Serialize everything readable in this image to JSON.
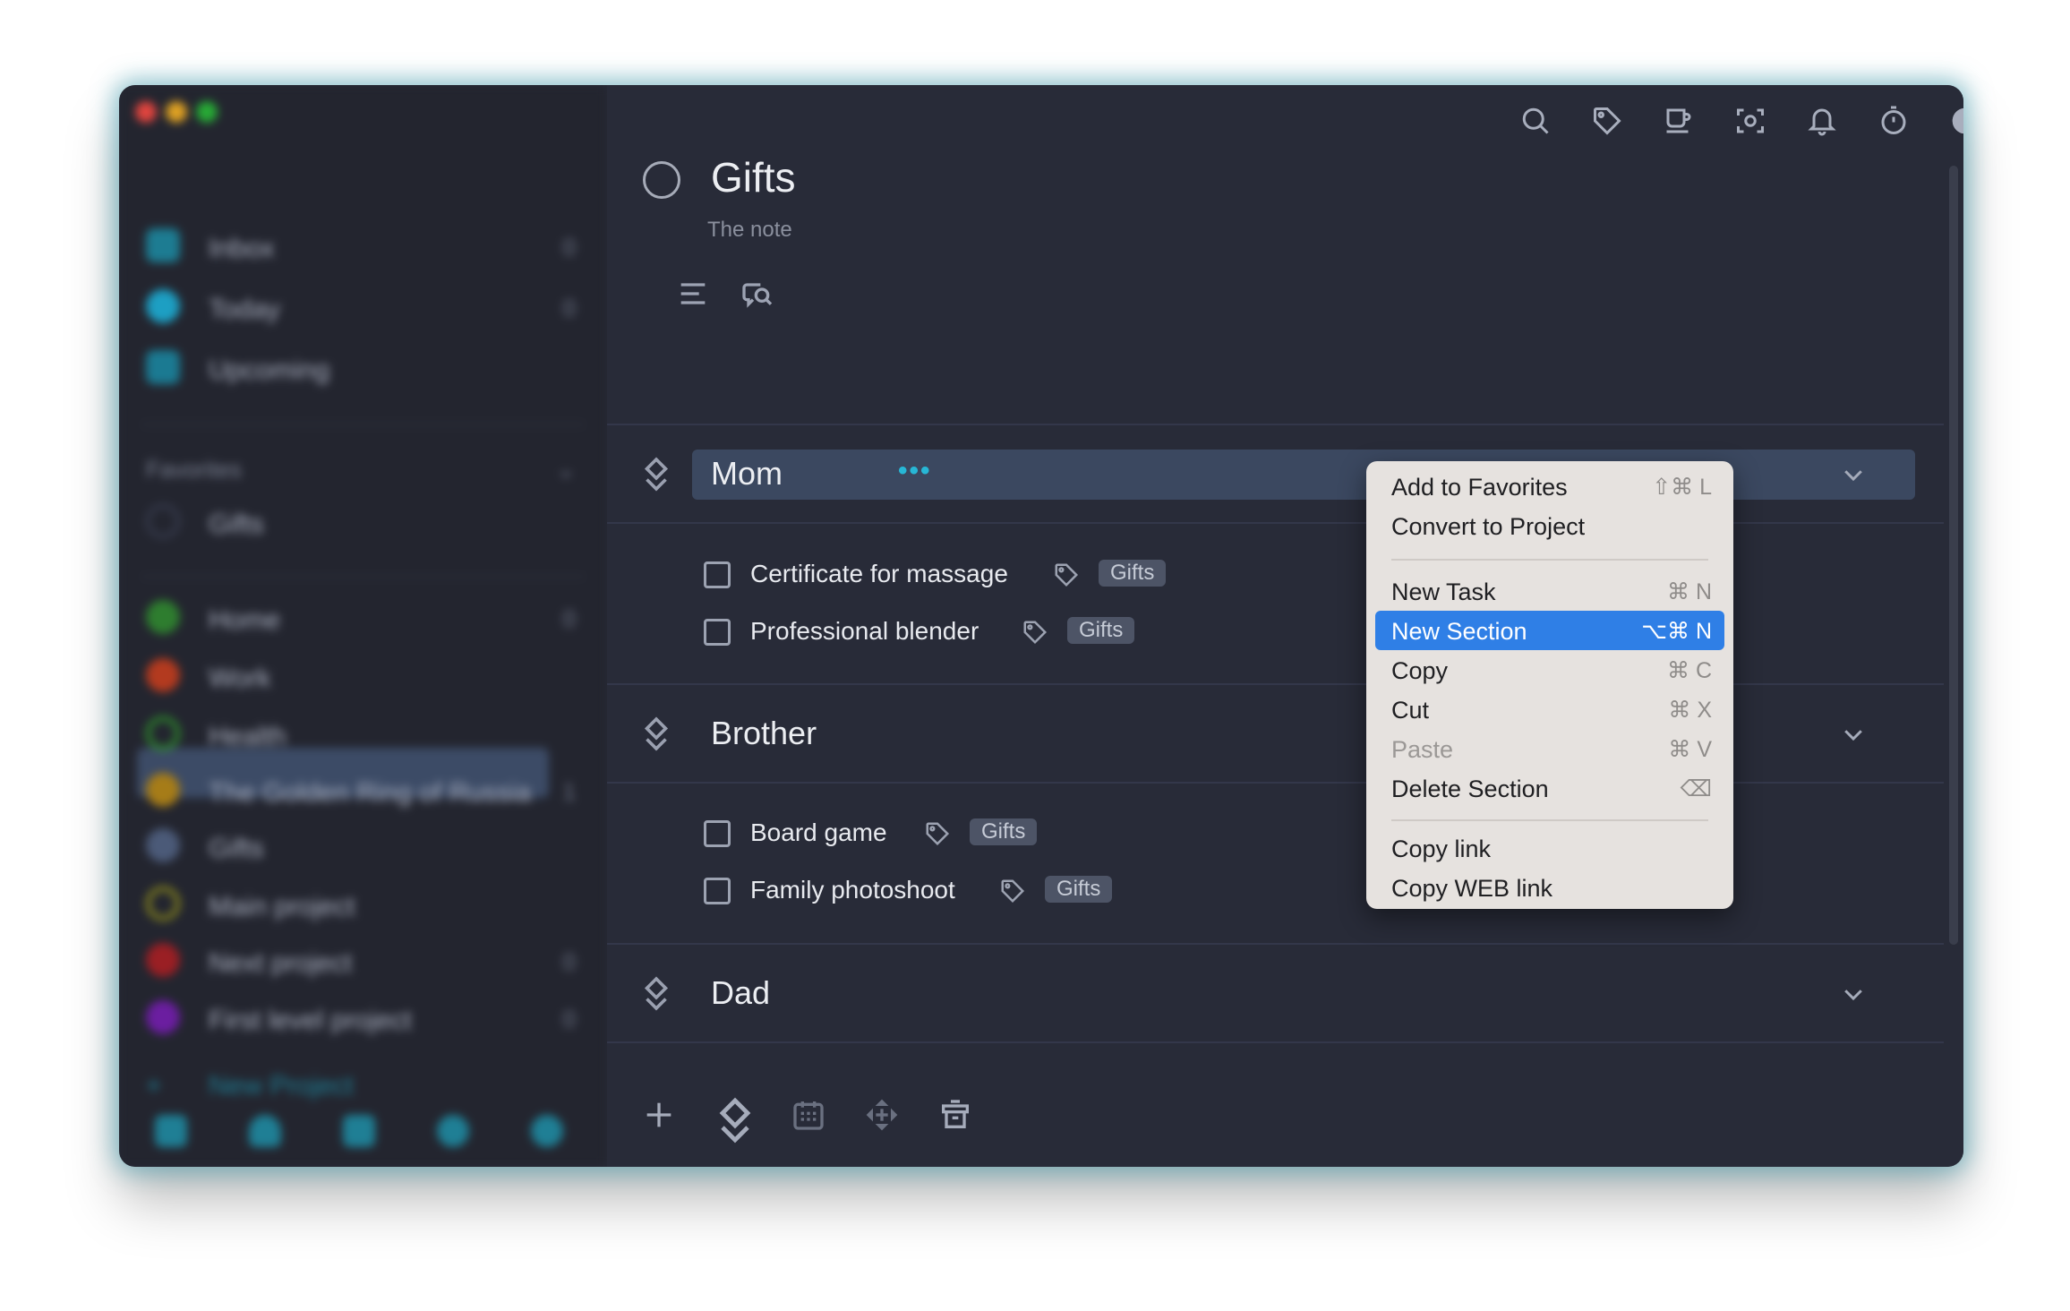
{
  "sidebar": {
    "items": [
      {
        "label": "Inbox",
        "count": "0",
        "color": "#1d7c92"
      },
      {
        "label": "Today",
        "count": "0",
        "color": "#1d9fc3"
      },
      {
        "label": "Upcoming",
        "count": "",
        "color": "#1b7a92"
      }
    ],
    "favorites_heading": "Favorites",
    "favorites": [
      {
        "label": "Gifts",
        "color": "#3a3f52"
      }
    ],
    "projects": [
      {
        "label": "Home",
        "count": "0",
        "color": "#2e7d2f"
      },
      {
        "label": "Work",
        "count": "",
        "color": "#b33a1f"
      },
      {
        "label": "Health",
        "count": "",
        "color": "#2d8f2b"
      },
      {
        "label": "The Golden Ring of Russia",
        "count": "1",
        "color": "#a67c18"
      },
      {
        "label": "Gifts",
        "count": "",
        "color": "#3c4b66"
      },
      {
        "label": "Main project",
        "count": "",
        "color": "#8c8a1c"
      },
      {
        "label": "Next project",
        "count": "0",
        "color": "#9a1f24"
      },
      {
        "label": "First level project",
        "count": "0",
        "color": "#6b1ea0"
      }
    ],
    "new_project": "New Project",
    "accent_color": "#1f7f95"
  },
  "toolbar": {
    "icons": [
      "search-icon",
      "tag-icon",
      "coffee-icon",
      "focus-icon",
      "bell-icon",
      "timer-icon",
      "contrast-icon",
      "duplicate-icon"
    ]
  },
  "project": {
    "title": "Gifts",
    "note": "The note",
    "note_icons": [
      "list-icon",
      "search-comment-icon"
    ]
  },
  "sections": [
    {
      "title": "Mom",
      "more": "•••",
      "tasks": [
        {
          "label": "Certificate for massage",
          "tag": "Gifts"
        },
        {
          "label": "Professional blender",
          "tag": "Gifts"
        }
      ]
    },
    {
      "title": "Brother",
      "tasks": [
        {
          "label": "Board game",
          "tag": "Gifts"
        },
        {
          "label": "Family photoshoot",
          "tag": "Gifts"
        }
      ]
    },
    {
      "title": "Dad",
      "tasks": []
    }
  ],
  "context_menu": {
    "items": [
      {
        "label": "Add to Favorites",
        "shortcut": "⇧⌘ L"
      },
      {
        "label": "Convert to Project",
        "shortcut": ""
      },
      {
        "label": "New Task",
        "shortcut": "⌘ N"
      },
      {
        "label": "New Section",
        "shortcut": "⌥⌘ N",
        "highlighted": true
      },
      {
        "label": "Copy",
        "shortcut": "⌘ C"
      },
      {
        "label": "Cut",
        "shortcut": "⌘ X"
      },
      {
        "label": "Paste",
        "shortcut": "⌘ V",
        "disabled": true
      },
      {
        "label": "Delete Section",
        "shortcut": "⌫"
      },
      {
        "label": "Copy link",
        "shortcut": ""
      },
      {
        "label": "Copy WEB link",
        "shortcut": ""
      }
    ]
  },
  "bottom_toolbar": {
    "icons": [
      "add-icon",
      "section-icon",
      "calendar-icon",
      "move-icon",
      "trash-icon",
      "sync-icon"
    ]
  },
  "colors": {
    "background": "#282b38",
    "accent": "#27b7d6",
    "highlight": "#2f7fe6",
    "tag_background": "#4d5466"
  }
}
